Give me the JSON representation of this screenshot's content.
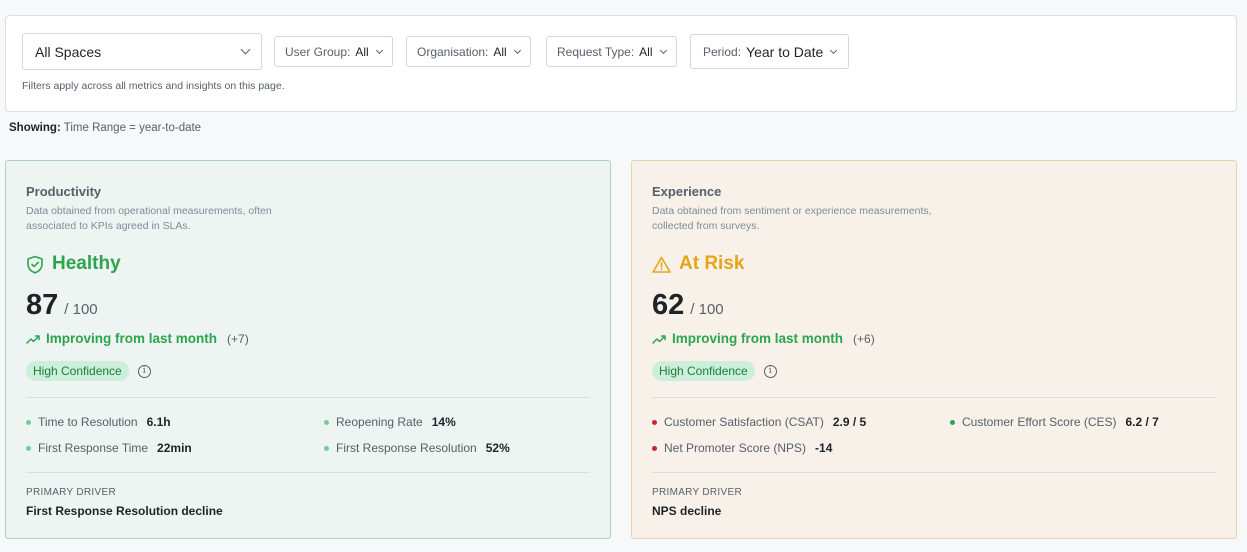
{
  "filters": {
    "space": "All Spaces",
    "user_group": {
      "label": "User Group:",
      "value": "All"
    },
    "organisation": {
      "label": "Organisation:",
      "value": "All"
    },
    "request_type": {
      "label": "Request Type:",
      "value": "All"
    },
    "period": {
      "label": "Period:",
      "value": "Year to Date"
    },
    "hint": "Filters apply across all metrics and insights on this page."
  },
  "showing": {
    "label": "Showing:",
    "text": "Time Range = year-to-date"
  },
  "productivity": {
    "title": "Productivity",
    "description": "Data obtained from operational measurements, often associated to KPIs agreed in SLAs.",
    "status": "Healthy",
    "status_color": "#2da44e",
    "score": "87",
    "score_max": "/ 100",
    "trend": "Improving from last month",
    "delta": "(+7)",
    "confidence": "High Confidence",
    "metrics": [
      {
        "label": "Time to Resolution",
        "value": "6.1h",
        "color": "#6fcf97"
      },
      {
        "label": "Reopening Rate",
        "value": "14%",
        "color": "#6fcf97"
      },
      {
        "label": "First Response Time",
        "value": "22min",
        "color": "#6fcf97"
      },
      {
        "label": "First Response Resolution",
        "value": "52%",
        "color": "#6fcf97"
      }
    ],
    "driver_label": "PRIMARY DRIVER",
    "driver": "First Response Resolution decline"
  },
  "experience": {
    "title": "Experience",
    "description": "Data obtained from sentiment or experience measurements, collected from surveys.",
    "status": "At Risk",
    "status_color": "#e8a317",
    "score": "62",
    "score_max": "/ 100",
    "trend": "Improving from last month",
    "delta": "(+6)",
    "confidence": "High Confidence",
    "metrics": [
      {
        "label": "Customer Satisfaction (CSAT)",
        "value": "2.9 / 5",
        "color": "#cf222e"
      },
      {
        "label": "Customer Effort Score (CES)",
        "value": "6.2 / 7",
        "color": "#2da44e"
      },
      {
        "label": "Net Promoter Score (NPS)",
        "value": "-14",
        "color": "#cf222e"
      }
    ],
    "driver_label": "PRIMARY DRIVER",
    "driver": "NPS decline"
  }
}
